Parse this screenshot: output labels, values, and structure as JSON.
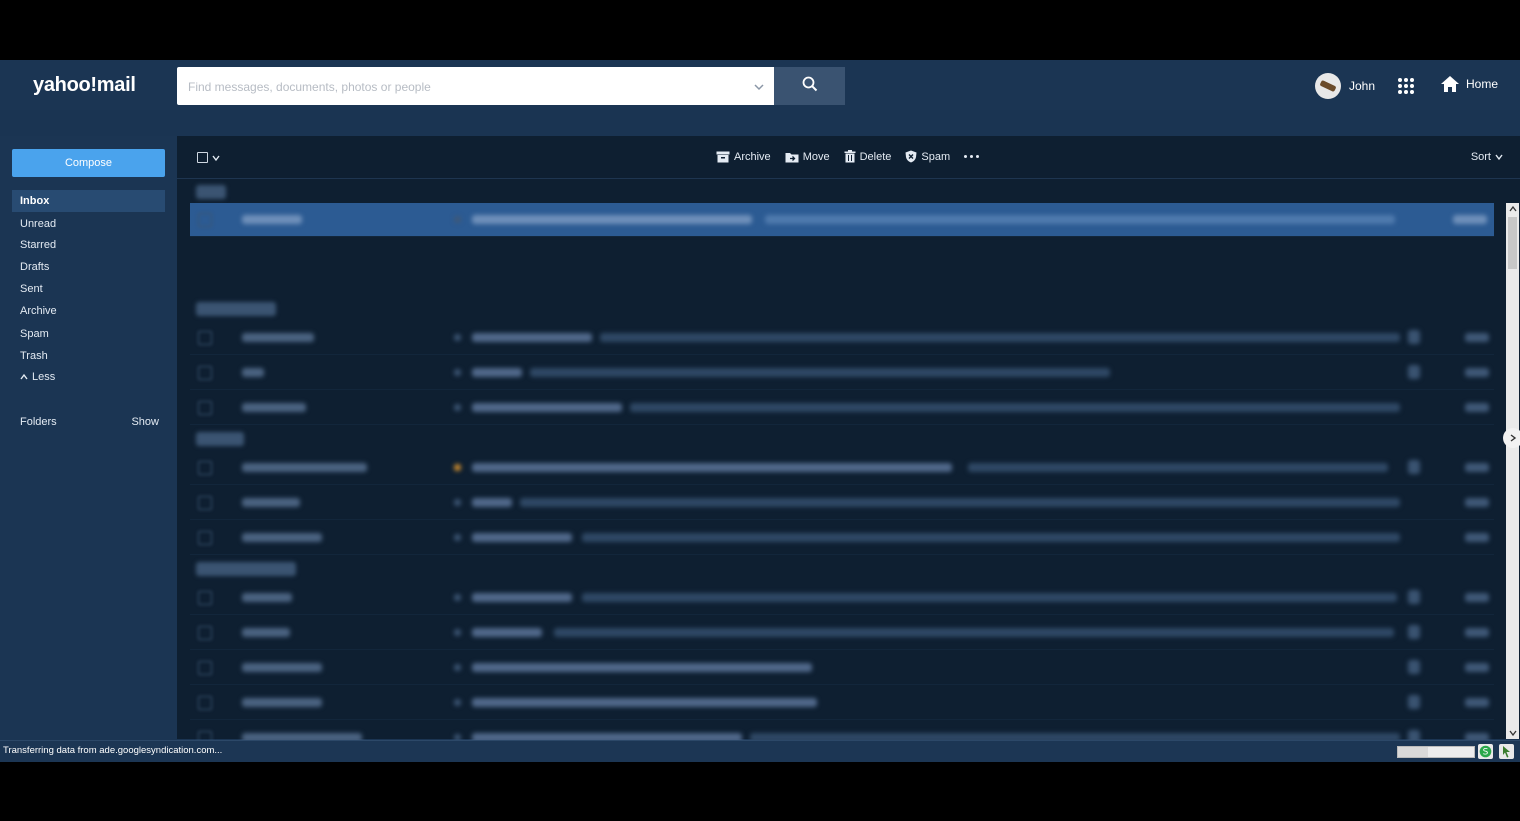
{
  "app": {
    "logo_text": "yahoo!mail"
  },
  "search": {
    "placeholder": "Find messages, documents, photos or people"
  },
  "account": {
    "user_name": "John",
    "home_label": "Home"
  },
  "sidebar": {
    "compose_label": "Compose",
    "items": [
      {
        "label": "Inbox",
        "active": true
      },
      {
        "label": "Unread"
      },
      {
        "label": "Starred"
      },
      {
        "label": "Drafts"
      },
      {
        "label": "Sent"
      },
      {
        "label": "Archive"
      },
      {
        "label": "Spam"
      },
      {
        "label": "Trash"
      }
    ],
    "less_label": "Less",
    "folders_label": "Folders",
    "folders_action": "Show"
  },
  "toolbar": {
    "archive_label": "Archive",
    "move_label": "Move",
    "delete_label": "Delete",
    "spam_label": "Spam",
    "sort_label": "Sort"
  },
  "statusbar": {
    "text": "Transferring data from ade.googlesyndication.com..."
  },
  "colors": {
    "app_bg": "#1b3553",
    "list_bg": "#0e1f31",
    "compose_blue": "#4aa3ed",
    "selected_row": "#2c5b93",
    "star_orange": "#d8922e"
  }
}
